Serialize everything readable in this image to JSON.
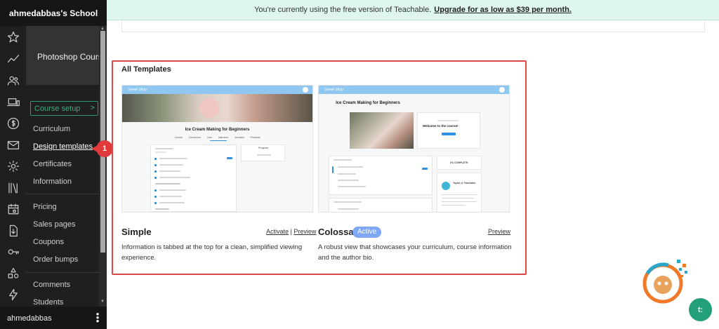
{
  "school_name": "ahmedabbas's School",
  "course": {
    "title": "Photoshop Course"
  },
  "sidebar": {
    "setup_label": "Course setup",
    "setup_chevron": ">",
    "items": [
      "Curriculum",
      "Design templates",
      "Certificates",
      "Information",
      "Pricing",
      "Sales pages",
      "Coupons",
      "Order bumps",
      "Comments",
      "Students"
    ],
    "active_item": "Design templates",
    "rail_icons": [
      "star-icon",
      "chart-icon",
      "users-icon",
      "devices-icon",
      "dollar-icon",
      "mail-icon",
      "gear-icon",
      "library-icon",
      "calendar-icon",
      "download-icon",
      "key-icon",
      "shapes-icon",
      "bolt-icon"
    ]
  },
  "user": {
    "name": "ahmedabbas",
    "menu_icon": "⋮"
  },
  "callout": {
    "number": "1",
    "color": "#e03a3a"
  },
  "banner": {
    "text": "You're currently using the free version of Teachable.",
    "link": "Upgrade for as low as $39 per month.",
    "bg": "#dff6ef"
  },
  "templates": {
    "section_title": "All Templates",
    "items": [
      {
        "name": "Simple",
        "activate": "Activate",
        "separator": "|",
        "preview": "Preview",
        "description": "Information is tabbed at the top for a clean, simplified viewing experience.",
        "thumb": {
          "title": "Ice Cream Making for Beginners",
          "tabs": "Course Curriculum Your Instructor Included Products",
          "progress_label": "Progress"
        }
      },
      {
        "name": "Colossal",
        "badge": "Active",
        "preview": "Preview",
        "description": "A robust view that showcases your curriculum, course information and the author bio.",
        "thumb": {
          "title": "Ice Cream Making for Beginners",
          "welcome": "Welcome to the course!",
          "complete": "0% COMPLETE",
          "author": "Taylor @ Teachable"
        }
      }
    ]
  },
  "chat": {
    "label": "t:"
  },
  "accent": "#23a07a",
  "highlight": "#e04848"
}
